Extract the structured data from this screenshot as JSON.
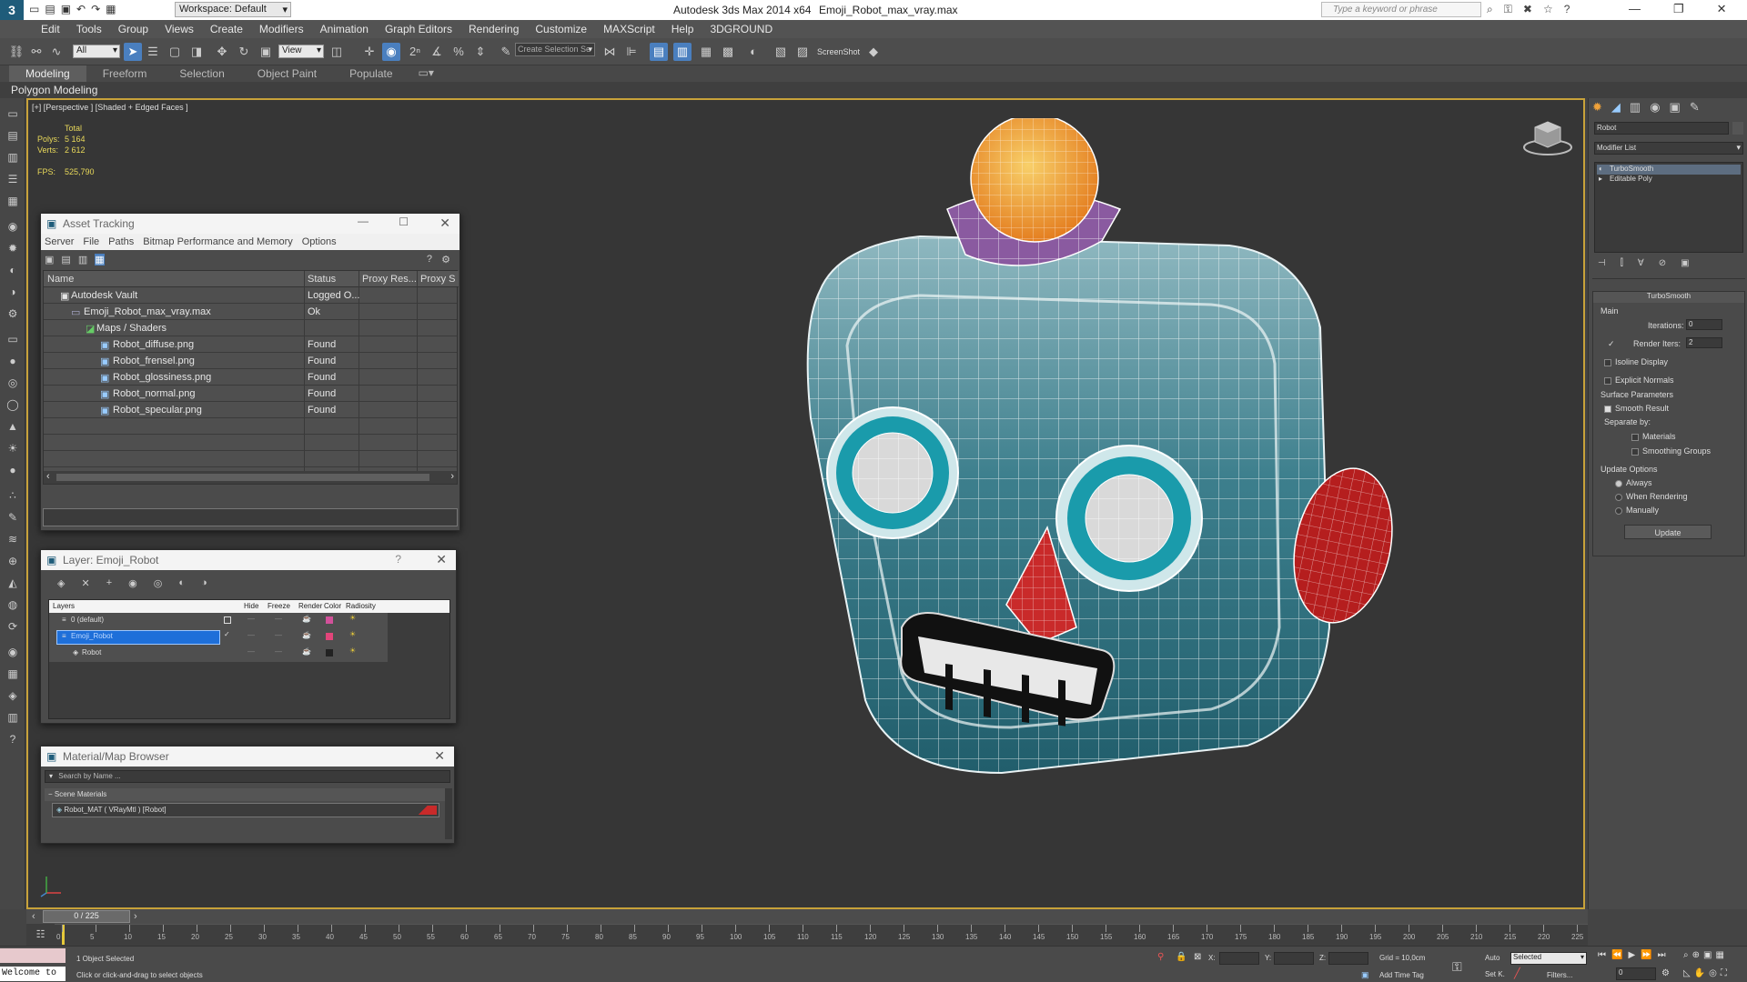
{
  "titlebar": {
    "workspace": "Workspace: Default",
    "app_title": "Autodesk 3ds Max  2014 x64",
    "file_name": "Emoji_Robot_max_vray.max",
    "search_placeholder": "Type a keyword or phrase"
  },
  "menu": [
    "Edit",
    "Tools",
    "Group",
    "Views",
    "Create",
    "Modifiers",
    "Animation",
    "Graph Editors",
    "Rendering",
    "Customize",
    "MAXScript",
    "Help",
    "3DGROUND"
  ],
  "toolbar": {
    "filter_value": "All",
    "ref_coord_value": "View",
    "selection_set_placeholder": "Create Selection Se",
    "screenshot_label": "ScreenShot"
  },
  "ribbon": {
    "tabs": [
      "Modeling",
      "Freeform",
      "Selection",
      "Object Paint",
      "Populate"
    ],
    "active_tab": "Modeling",
    "subtab": "Polygon Modeling"
  },
  "viewport": {
    "label": "[+] [Perspective ] [Shaded + Edged Faces ]",
    "stats_header": "Total",
    "polys_label": "Polys:",
    "polys_value": "5 164",
    "verts_label": "Verts:",
    "verts_value": "2 612",
    "fps_label": "FPS:",
    "fps_value": "525,790"
  },
  "asset_tracking": {
    "title": "Asset Tracking",
    "menu": [
      "Server",
      "File",
      "Paths",
      "Bitmap Performance and Memory",
      "Options"
    ],
    "columns": [
      "Name",
      "Status",
      "Proxy Res...",
      "Proxy S"
    ],
    "rows": [
      {
        "name": "Autodesk Vault",
        "status": "Logged O...",
        "indent": 1
      },
      {
        "name": "Emoji_Robot_max_vray.max",
        "status": "Ok",
        "indent": 2
      },
      {
        "name": "Maps / Shaders",
        "status": "",
        "indent": 3
      },
      {
        "name": "Robot_diffuse.png",
        "status": "Found",
        "indent": 4
      },
      {
        "name": "Robot_frensel.png",
        "status": "Found",
        "indent": 4
      },
      {
        "name": "Robot_glossiness.png",
        "status": "Found",
        "indent": 4
      },
      {
        "name": "Robot_normal.png",
        "status": "Found",
        "indent": 4
      },
      {
        "name": "Robot_specular.png",
        "status": "Found",
        "indent": 4
      }
    ]
  },
  "layer_panel": {
    "title": "Layer: Emoji_Robot",
    "help": "?",
    "columns": [
      "Layers",
      "Hide",
      "Freeze",
      "Render",
      "Color",
      "Radiosity"
    ],
    "rows": [
      {
        "name": "0 (default)",
        "color": "#d2519a",
        "selected": false
      },
      {
        "name": "Emoji_Robot",
        "color": "#e2457a",
        "selected": true
      },
      {
        "name": "Robot",
        "color": "#222222",
        "selected": false
      }
    ]
  },
  "material_browser": {
    "title": "Material/Map Browser",
    "search_placeholder": "Search by Name ...",
    "group": "Scene Materials",
    "item": "Robot_MAT  ( VRayMtl )  [Robot]"
  },
  "command_panel": {
    "object_name": "Robot",
    "modifier_list": "Modifier List",
    "stack": [
      "TurboSmooth",
      "Editable Poly"
    ],
    "rollout_title": "TurboSmooth",
    "main_label": "Main",
    "iterations_label": "Iterations:",
    "iterations_value": "0",
    "render_iters_label": "Render Iters:",
    "render_iters_value": "2",
    "isoline": "Isoline Display",
    "explicit": "Explicit Normals",
    "surface_label": "Surface Parameters",
    "smooth_result": "Smooth Result",
    "separate_by": "Separate by:",
    "materials": "Materials",
    "smoothing_groups": "Smoothing Groups",
    "update_options": "Update Options",
    "always": "Always",
    "when_rendering": "When Rendering",
    "manually": "Manually",
    "update_button": "Update"
  },
  "timeline": {
    "frame": "0 / 225",
    "ticks": [
      "0",
      "5",
      "10",
      "15",
      "20",
      "25",
      "30",
      "35",
      "40",
      "45",
      "50",
      "55",
      "60",
      "65",
      "70",
      "75",
      "80",
      "85",
      "90",
      "95",
      "100",
      "105",
      "110",
      "115",
      "120",
      "125",
      "130",
      "135",
      "140",
      "145",
      "150",
      "155",
      "160",
      "165",
      "170",
      "175",
      "180",
      "185",
      "190",
      "195",
      "200",
      "205",
      "210",
      "215",
      "220",
      "225"
    ]
  },
  "status": {
    "welcome": "Welcome to",
    "selected": "1 Object Selected",
    "hint": "Click or click-and-drag to select objects",
    "x_label": "X:",
    "y_label": "Y:",
    "z_label": "Z:",
    "grid": "Grid = 10,0cm",
    "add_time_tag": "Add Time Tag",
    "auto": "Auto",
    "setk": "Set K.",
    "key_mode": "Selected",
    "filters": "Filters...",
    "frame_value": "0"
  },
  "colors": {
    "accent": "#4a7fbf",
    "viewport_border": "#c8a23a",
    "robot_body": "#2a6f80",
    "robot_nose": "#c92a2a",
    "robot_ball": "#f0a23a",
    "robot_collar": "#8a5aa0"
  }
}
